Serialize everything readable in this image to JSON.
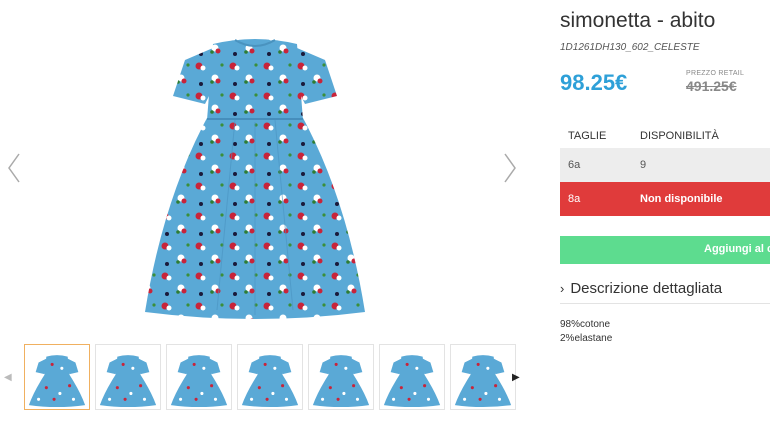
{
  "product": {
    "title": "simonetta - abito",
    "sku": "1D1261DH130_602_CELESTE",
    "price": "98.25€",
    "retail_label": "PREZZO RETAIL",
    "retail_price": "491.25€"
  },
  "sizes": {
    "header_size": "TAGLIE",
    "header_availability": "DISPONIBILITÀ",
    "rows": [
      {
        "size": "6a",
        "availability": "9"
      },
      {
        "size": "8a",
        "availability": "Non disponibile"
      }
    ]
  },
  "cart": {
    "label": "Aggiungi al ca"
  },
  "description": {
    "toggle_label": "Descrizione dettagliata",
    "composition": [
      "98%cotone",
      "2%elastane"
    ]
  },
  "gallery": {
    "thumbnail_count": 7,
    "active_thumbnail": 1
  },
  "colors": {
    "price": "#2ea0d8",
    "unavailable": "#e03b3b",
    "cart_button": "#5ddc8f",
    "dress": "#5aa9d6"
  },
  "icons": {
    "prev": "chevron-left-icon",
    "next": "chevron-right-icon",
    "expand": "chevron-right-icon"
  }
}
